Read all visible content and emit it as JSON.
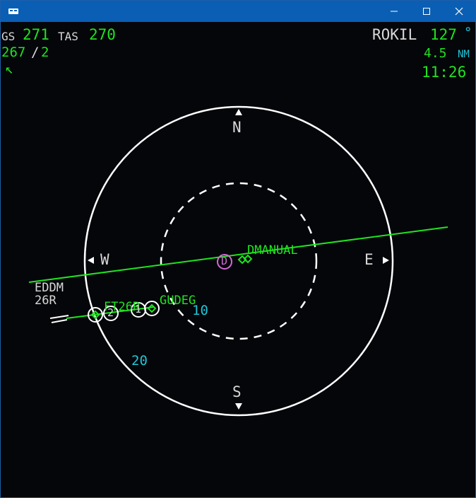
{
  "display": {
    "gs_label": "GS",
    "gs_value": "271",
    "tas_label": "TAS",
    "tas_value": "270",
    "wind_dir": "267",
    "wind_sep": "/",
    "wind_speed": "2",
    "wind_arrow": "↖",
    "next_waypoint": "ROKIL",
    "next_waypoint_bearing": "127",
    "degree_symbol": "°",
    "distance_value": "4.5",
    "distance_unit": "NM",
    "eta": "11:26"
  },
  "compass": {
    "north": "N",
    "south": "S",
    "east": "E",
    "west": "W"
  },
  "range_labels": {
    "inner": "10",
    "outer": "20"
  },
  "airport": {
    "name": "EDDM",
    "runway": "26R"
  },
  "waypoints": {
    "dmanual": "DMANUAL",
    "ft": "FT26R",
    "gudeg": "GUDEG",
    "d_marker": "D",
    "marker_1": "1",
    "marker_2": "2"
  },
  "colors": {
    "route": "#1ee41e",
    "text_white": "#d8d8d8",
    "range_cyan": "#1fc6d6",
    "magenta": "#d36ad6",
    "background": "#05060a",
    "titlebar": "#0a5fb4"
  }
}
